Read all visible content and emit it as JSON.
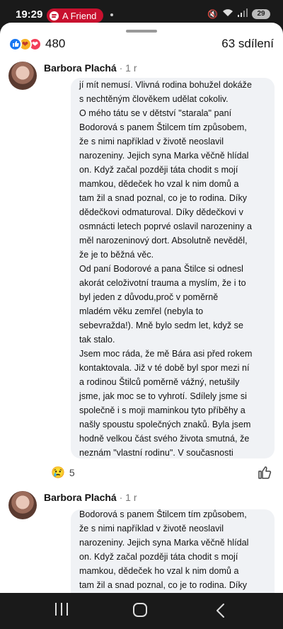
{
  "status": {
    "time": "19:29",
    "media_pill": "A Friend",
    "battery": "29"
  },
  "post": {
    "reaction_count": "480",
    "shares": "63 sdílení",
    "reaction_icons": [
      "like-icon",
      "care-icon",
      "love-icon"
    ]
  },
  "comments": [
    {
      "author": "Barbora Plachá",
      "time": "· 1 r",
      "text": "jí mít nemusí. Vlivná rodina bohužel dokáže\ns nechtěným člověkem udělat cokoliv.\nO mého tátu se v dětství \"starala\" paní\nBodorová s panem Štilcem tím způsobem,\nže s nimi například v životě neoslavil\nnarozeniny. Jejich syna Marka věčně hlídal\non. Když začal později táta chodit s mojí\nmamkou, dědeček ho vzal k nim domů a\ntam žil a snad poznal, co je to rodina. Díky\ndědečkovi odmaturoval. Díky dědečkovi v\nosmnácti letech poprvé oslavil narozeniny a\nměl narozeninový dort. Absolutně nevěděl,\nže je to běžná věc.\nOd paní Bodorové a pana Štilce si odnesl\nakorát celoživotní trauma a myslím, že i to\nbyl jeden z důvodu,proč v poměrně\nmladém věku zemřel (nebyla to\nsebevražda!). Mně bylo sedm let, když se\ntak stalo.\nJsem moc ráda, že mě Bára asi před rokem\nkontaktovala. Již v té době byl spor mezi ní\na rodinou Štilců poměrně vážný, netušily\njsme, jak moc se to vyhrotí. Sdílely jsme si\nspolečně i s moji maminkou tyto příběhy a\nnašly spoustu společných znaků. Byla jsem\nhodně velkou část svého života smutná, že\nneznám \"vlastní rodinu\". V současnosti\njsem vděčná, že o mě nikdy nejevili zájem!!\nJsem připravená čelit kritice i kontaktování\nze strany Štilců, ale zároveň cítím povinnost\nse v tomto vyjádřit a nestát stranou. Přeju\nsi,aby Bertíkův a Báry příběh dopadl dobře.",
      "reaction_count": "5"
    },
    {
      "author": "Barbora Plachá",
      "time": "· 1 r",
      "text": "Bodorová s panem Štilcem tím způsobem,\nže s nimi například v životě neoslavil\nnarozeniny. Jejich syna Marka věčně hlídal\non. Když začal později táta chodit s mojí\nmamkou, dědeček ho vzal k nim domů a\ntam žil a snad poznal, co je to rodina. Díky\ndědečkovi odmaturoval. Díky dědečkovi v"
    }
  ]
}
